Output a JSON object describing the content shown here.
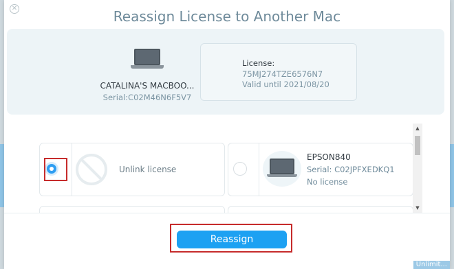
{
  "dialog": {
    "title": "Reassign License to Another Mac",
    "close_icon": "close-icon"
  },
  "current_mac": {
    "name": "CATALINA'S MACBOO...",
    "serial": "Serial:C02M46N6F5V7",
    "icon": "laptop-icon"
  },
  "license": {
    "label": "License:",
    "key": "75MJ274TZE6576N7",
    "valid": "Valid until 2021/08/20"
  },
  "options": {
    "unlink": {
      "label": "Unlink license",
      "selected": true,
      "icon": "unlink-icon"
    },
    "devices": [
      {
        "name": "EPSON840",
        "serial": "Serial: C02JPFXEDKQ1",
        "status": "No license",
        "selected": false,
        "icon": "laptop-icon"
      }
    ]
  },
  "footer": {
    "reassign_label": "Reassign"
  },
  "background": {
    "partial_text": "Unlimit..."
  },
  "colors": {
    "accent": "#1da1f2",
    "highlight": "#c62b2b",
    "title": "#6e8a9a"
  }
}
